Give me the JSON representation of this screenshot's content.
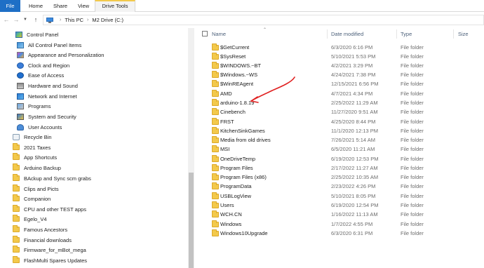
{
  "ribbon": {
    "tabs": [
      "File",
      "Home",
      "Share",
      "View",
      "Drive Tools"
    ]
  },
  "address": {
    "crumbs": [
      "This PC",
      "M2 Drive (C:)"
    ]
  },
  "nav_pane": {
    "items": [
      {
        "label": "Control Panel",
        "icon": "control-panel-icon"
      },
      {
        "label": "All Control Panel Items",
        "icon": "control-panel-icon"
      },
      {
        "label": "Appearance and Personalization",
        "icon": "appearance-icon"
      },
      {
        "label": "Clock and Region",
        "icon": "clock-icon"
      },
      {
        "label": "Ease of Access",
        "icon": "ease-of-access-icon"
      },
      {
        "label": "Hardware and Sound",
        "icon": "hardware-icon"
      },
      {
        "label": "Network and Internet",
        "icon": "network-icon"
      },
      {
        "label": "Programs",
        "icon": "programs-icon"
      },
      {
        "label": "System and Security",
        "icon": "system-security-icon"
      },
      {
        "label": "User Accounts",
        "icon": "user-accounts-icon"
      },
      {
        "label": "Recycle Bin",
        "icon": "recycle-bin-icon"
      },
      {
        "label": "2021 Taxes",
        "icon": "folder-icon"
      },
      {
        "label": "App Shortcuts",
        "icon": "folder-icon"
      },
      {
        "label": "Arduino Backup",
        "icon": "folder-icon"
      },
      {
        "label": "BAckup and Sync scm grabs",
        "icon": "folder-icon"
      },
      {
        "label": "Clips and Picts",
        "icon": "folder-icon"
      },
      {
        "label": "Companion",
        "icon": "folder-icon"
      },
      {
        "label": "CPU and other TEST apps",
        "icon": "folder-icon"
      },
      {
        "label": "Egelo_V4",
        "icon": "folder-icon"
      },
      {
        "label": "Famous Ancestors",
        "icon": "folder-icon"
      },
      {
        "label": "Financial downloads",
        "icon": "folder-icon"
      },
      {
        "label": "Firmware_for_mBot_mega",
        "icon": "folder-icon"
      },
      {
        "label": "FlashMulti Spares Updates",
        "icon": "folder-icon"
      }
    ]
  },
  "file_list": {
    "columns": [
      "Name",
      "Date modified",
      "Type",
      "Size"
    ],
    "rows": [
      {
        "name": "$GetCurrent",
        "date": "6/3/2020 6:16 PM",
        "type": "File folder"
      },
      {
        "name": "$SysReset",
        "date": "5/10/2021 5:53 PM",
        "type": "File folder"
      },
      {
        "name": "$WINDOWS.~BT",
        "date": "4/2/2021 3:29 PM",
        "type": "File folder"
      },
      {
        "name": "$Windows.~WS",
        "date": "4/24/2021 7:38 PM",
        "type": "File folder"
      },
      {
        "name": "$WinREAgent",
        "date": "12/15/2021 6:56 PM",
        "type": "File folder"
      },
      {
        "name": "AMD",
        "date": "4/7/2021 4:34 PM",
        "type": "File folder"
      },
      {
        "name": "arduino-1.8.19",
        "date": "2/25/2022 11:29 AM",
        "type": "File folder"
      },
      {
        "name": "Cinebench",
        "date": "11/27/2020 9:51 AM",
        "type": "File folder"
      },
      {
        "name": "FRST",
        "date": "4/25/2020 8:44 PM",
        "type": "File folder"
      },
      {
        "name": "KitchenSinkGames",
        "date": "11/1/2020 12:13 PM",
        "type": "File folder"
      },
      {
        "name": "Media from old drives",
        "date": "7/26/2021 5:14 AM",
        "type": "File folder"
      },
      {
        "name": "MSI",
        "date": "6/5/2020 11:21 AM",
        "type": "File folder"
      },
      {
        "name": "OneDriveTemp",
        "date": "6/19/2020 12:53 PM",
        "type": "File folder"
      },
      {
        "name": "Program Files",
        "date": "2/17/2022 11:27 AM",
        "type": "File folder"
      },
      {
        "name": "Program Files (x86)",
        "date": "2/25/2022 10:35 AM",
        "type": "File folder"
      },
      {
        "name": "ProgramData",
        "date": "2/23/2022 4:26 PM",
        "type": "File folder"
      },
      {
        "name": "USBLogView",
        "date": "5/10/2021 8:05 PM",
        "type": "File folder"
      },
      {
        "name": "Users",
        "date": "6/19/2020 12:54 PM",
        "type": "File folder"
      },
      {
        "name": "WCH.CN",
        "date": "1/16/2022 11:13 AM",
        "type": "File folder"
      },
      {
        "name": "Windows",
        "date": "1/7/2022 4:55 PM",
        "type": "File folder"
      },
      {
        "name": "Windows10Upgrade",
        "date": "6/3/2020 6:31 PM",
        "type": "File folder"
      }
    ]
  },
  "colors": {
    "file_tab": "#1e6fc6",
    "folder": "#f3c94b",
    "header_text": "#4c607a",
    "annotation": "#e02020"
  }
}
